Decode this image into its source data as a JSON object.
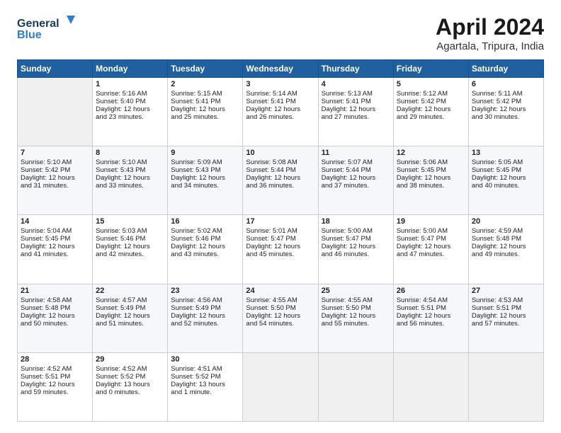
{
  "header": {
    "logo_line1": "General",
    "logo_line2": "Blue",
    "title": "April 2024",
    "subtitle": "Agartala, Tripura, India"
  },
  "calendar": {
    "days_of_week": [
      "Sunday",
      "Monday",
      "Tuesday",
      "Wednesday",
      "Thursday",
      "Friday",
      "Saturday"
    ],
    "weeks": [
      [
        {
          "day": "",
          "content": ""
        },
        {
          "day": "1",
          "content": "Sunrise: 5:16 AM\nSunset: 5:40 PM\nDaylight: 12 hours\nand 23 minutes."
        },
        {
          "day": "2",
          "content": "Sunrise: 5:15 AM\nSunset: 5:41 PM\nDaylight: 12 hours\nand 25 minutes."
        },
        {
          "day": "3",
          "content": "Sunrise: 5:14 AM\nSunset: 5:41 PM\nDaylight: 12 hours\nand 26 minutes."
        },
        {
          "day": "4",
          "content": "Sunrise: 5:13 AM\nSunset: 5:41 PM\nDaylight: 12 hours\nand 27 minutes."
        },
        {
          "day": "5",
          "content": "Sunrise: 5:12 AM\nSunset: 5:42 PM\nDaylight: 12 hours\nand 29 minutes."
        },
        {
          "day": "6",
          "content": "Sunrise: 5:11 AM\nSunset: 5:42 PM\nDaylight: 12 hours\nand 30 minutes."
        }
      ],
      [
        {
          "day": "7",
          "content": "Sunrise: 5:10 AM\nSunset: 5:42 PM\nDaylight: 12 hours\nand 31 minutes."
        },
        {
          "day": "8",
          "content": "Sunrise: 5:10 AM\nSunset: 5:43 PM\nDaylight: 12 hours\nand 33 minutes."
        },
        {
          "day": "9",
          "content": "Sunrise: 5:09 AM\nSunset: 5:43 PM\nDaylight: 12 hours\nand 34 minutes."
        },
        {
          "day": "10",
          "content": "Sunrise: 5:08 AM\nSunset: 5:44 PM\nDaylight: 12 hours\nand 36 minutes."
        },
        {
          "day": "11",
          "content": "Sunrise: 5:07 AM\nSunset: 5:44 PM\nDaylight: 12 hours\nand 37 minutes."
        },
        {
          "day": "12",
          "content": "Sunrise: 5:06 AM\nSunset: 5:45 PM\nDaylight: 12 hours\nand 38 minutes."
        },
        {
          "day": "13",
          "content": "Sunrise: 5:05 AM\nSunset: 5:45 PM\nDaylight: 12 hours\nand 40 minutes."
        }
      ],
      [
        {
          "day": "14",
          "content": "Sunrise: 5:04 AM\nSunset: 5:45 PM\nDaylight: 12 hours\nand 41 minutes."
        },
        {
          "day": "15",
          "content": "Sunrise: 5:03 AM\nSunset: 5:46 PM\nDaylight: 12 hours\nand 42 minutes."
        },
        {
          "day": "16",
          "content": "Sunrise: 5:02 AM\nSunset: 5:46 PM\nDaylight: 12 hours\nand 43 minutes."
        },
        {
          "day": "17",
          "content": "Sunrise: 5:01 AM\nSunset: 5:47 PM\nDaylight: 12 hours\nand 45 minutes."
        },
        {
          "day": "18",
          "content": "Sunrise: 5:00 AM\nSunset: 5:47 PM\nDaylight: 12 hours\nand 46 minutes."
        },
        {
          "day": "19",
          "content": "Sunrise: 5:00 AM\nSunset: 5:47 PM\nDaylight: 12 hours\nand 47 minutes."
        },
        {
          "day": "20",
          "content": "Sunrise: 4:59 AM\nSunset: 5:48 PM\nDaylight: 12 hours\nand 49 minutes."
        }
      ],
      [
        {
          "day": "21",
          "content": "Sunrise: 4:58 AM\nSunset: 5:48 PM\nDaylight: 12 hours\nand 50 minutes."
        },
        {
          "day": "22",
          "content": "Sunrise: 4:57 AM\nSunset: 5:49 PM\nDaylight: 12 hours\nand 51 minutes."
        },
        {
          "day": "23",
          "content": "Sunrise: 4:56 AM\nSunset: 5:49 PM\nDaylight: 12 hours\nand 52 minutes."
        },
        {
          "day": "24",
          "content": "Sunrise: 4:55 AM\nSunset: 5:50 PM\nDaylight: 12 hours\nand 54 minutes."
        },
        {
          "day": "25",
          "content": "Sunrise: 4:55 AM\nSunset: 5:50 PM\nDaylight: 12 hours\nand 55 minutes."
        },
        {
          "day": "26",
          "content": "Sunrise: 4:54 AM\nSunset: 5:51 PM\nDaylight: 12 hours\nand 56 minutes."
        },
        {
          "day": "27",
          "content": "Sunrise: 4:53 AM\nSunset: 5:51 PM\nDaylight: 12 hours\nand 57 minutes."
        }
      ],
      [
        {
          "day": "28",
          "content": "Sunrise: 4:52 AM\nSunset: 5:51 PM\nDaylight: 12 hours\nand 59 minutes."
        },
        {
          "day": "29",
          "content": "Sunrise: 4:52 AM\nSunset: 5:52 PM\nDaylight: 13 hours\nand 0 minutes."
        },
        {
          "day": "30",
          "content": "Sunrise: 4:51 AM\nSunset: 5:52 PM\nDaylight: 13 hours\nand 1 minute."
        },
        {
          "day": "",
          "content": ""
        },
        {
          "day": "",
          "content": ""
        },
        {
          "day": "",
          "content": ""
        },
        {
          "day": "",
          "content": ""
        }
      ]
    ]
  }
}
